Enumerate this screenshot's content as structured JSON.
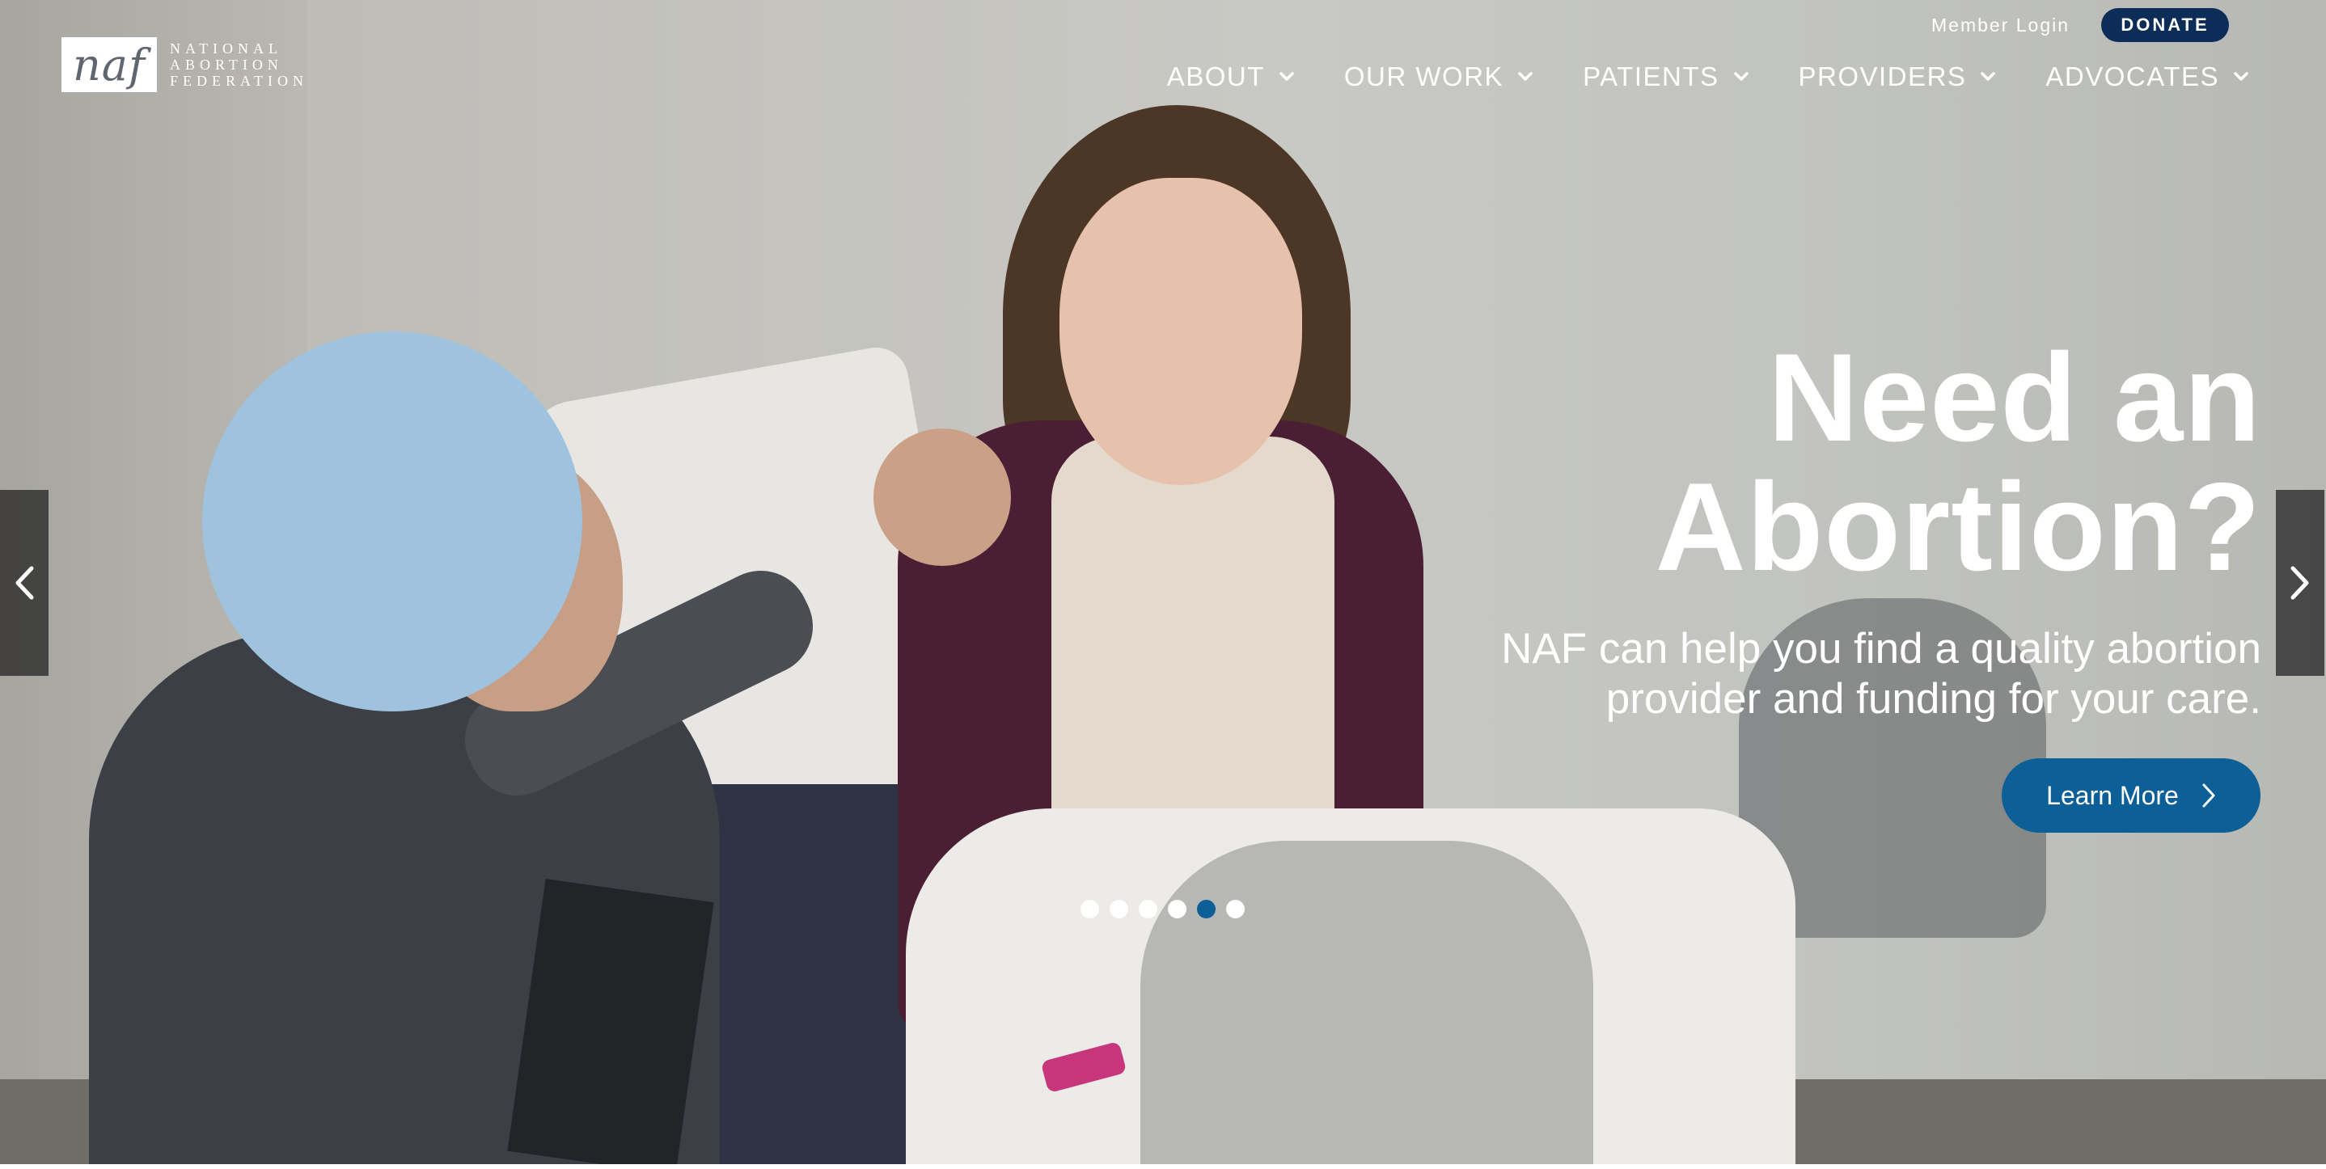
{
  "header": {
    "logo": {
      "mark": "naf",
      "lines": [
        "NATIONAL",
        "ABORTION",
        "FEDERATION"
      ]
    },
    "member_login": "Member Login",
    "donate": "DONATE",
    "nav": [
      {
        "label": "ABOUT",
        "icon": "chevron-down-icon"
      },
      {
        "label": "OUR WORK",
        "icon": "chevron-down-icon"
      },
      {
        "label": "PATIENTS",
        "icon": "chevron-down-icon"
      },
      {
        "label": "PROVIDERS",
        "icon": "chevron-down-icon"
      },
      {
        "label": "ADVOCATES",
        "icon": "chevron-down-icon"
      }
    ]
  },
  "hero": {
    "headline_line1": "Need an",
    "headline_line2": "Abortion?",
    "subtext_line1": "NAF can help you find a quality abortion",
    "subtext_line2": "provider and funding for your care.",
    "cta": "Learn More",
    "cta_icon": "chevron-right-icon",
    "slides_total": 6,
    "active_slide": 5
  },
  "carousel": {
    "prev_icon": "chevron-left-icon",
    "next_icon": "chevron-right-icon"
  },
  "colors": {
    "donate_bg": "#0b2d57",
    "accent": "#0d5f97",
    "text": "#ffffff"
  }
}
